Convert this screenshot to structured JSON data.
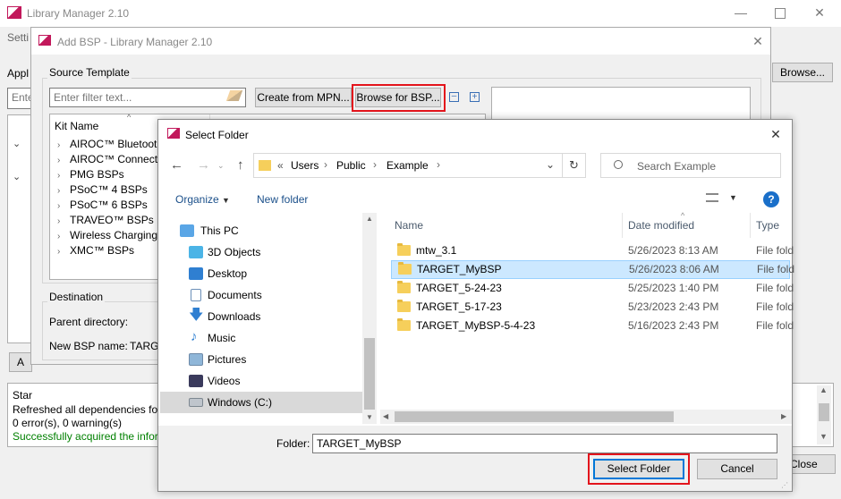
{
  "main_window": {
    "title": "Library Manager 2.10",
    "menu_partial": "Setti",
    "appl_partial": "Appl",
    "enter_partial": "Ente",
    "browse_label": "Browse...",
    "add_partial": "A",
    "close_partial": "Close",
    "log_lines": [
      "Star",
      "Refreshed all dependencies for",
      "0 error(s), 0 warning(s)",
      "Successfully acquired the infor"
    ]
  },
  "add_bsp": {
    "title": "Add BSP - Library Manager 2.10",
    "source_template_label": "Source Template",
    "filter_placeholder": "Enter filter text...",
    "create_from_mpn": "Create from MPN...",
    "browse_for_bsp": "Browse for BSP...",
    "kit_name_header": "Kit Name",
    "kits": [
      "AIROC™ Bluetooth",
      "AIROC™ Connectiv",
      "PMG BSPs",
      "PSoC™ 4 BSPs",
      "PSoC™ 6 BSPs",
      "TRAVEO™ BSPs",
      "Wireless Charging",
      "XMC™ BSPs"
    ],
    "destination_label": "Destination",
    "parent_directory_label": "Parent directory:",
    "new_bsp_name_label": "New BSP name:",
    "new_bsp_name_value": "TARGE"
  },
  "select_folder": {
    "title": "Select Folder",
    "breadcrumb": {
      "overflow": "«",
      "parts": [
        "Users",
        "Public",
        "Example"
      ]
    },
    "search_placeholder": "Search Example",
    "organize_label": "Organize",
    "new_folder_label": "New folder",
    "nav_items": [
      {
        "label": "This PC",
        "icon": "computer-icon"
      },
      {
        "label": "3D Objects",
        "icon": "3d-objects-icon"
      },
      {
        "label": "Desktop",
        "icon": "desktop-icon"
      },
      {
        "label": "Documents",
        "icon": "documents-icon"
      },
      {
        "label": "Downloads",
        "icon": "downloads-icon"
      },
      {
        "label": "Music",
        "icon": "music-icon"
      },
      {
        "label": "Pictures",
        "icon": "pictures-icon"
      },
      {
        "label": "Videos",
        "icon": "videos-icon"
      },
      {
        "label": "Windows (C:)",
        "icon": "drive-icon"
      }
    ],
    "columns": {
      "name": "Name",
      "date": "Date modified",
      "type": "Type"
    },
    "files": [
      {
        "name": "mtw_3.1",
        "date": "5/26/2023 8:13 AM",
        "type": "File fold"
      },
      {
        "name": "TARGET_MyBSP",
        "date": "5/26/2023 8:06 AM",
        "type": "File fold"
      },
      {
        "name": "TARGET_5-24-23",
        "date": "5/25/2023 1:40 PM",
        "type": "File fold"
      },
      {
        "name": "TARGET_5-17-23",
        "date": "5/23/2023 2:43 PM",
        "type": "File fold"
      },
      {
        "name": "TARGET_MyBSP-5-4-23",
        "date": "5/16/2023 2:43 PM",
        "type": "File fold"
      }
    ],
    "folder_label": "Folder:",
    "folder_value": "TARGET_MyBSP",
    "select_button": "Select Folder",
    "cancel_button": "Cancel"
  },
  "colors": {
    "highlight_red": "#e3141c",
    "selection_blue": "#cce8ff",
    "log_green": "#008000",
    "link_blue": "#1a4f8a"
  }
}
